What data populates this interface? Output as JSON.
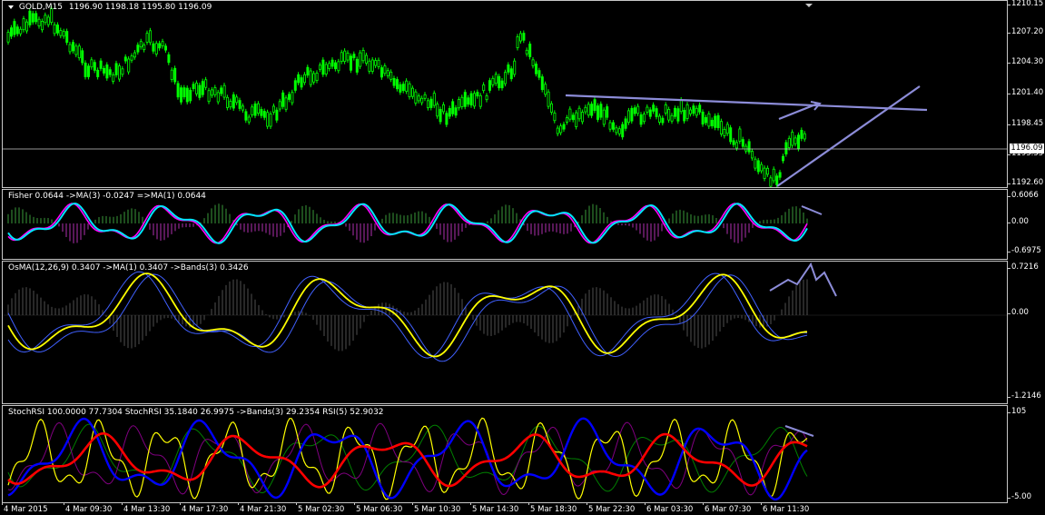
{
  "chart_title": {
    "symbol": "GOLD,M15",
    "ohlc": "1196.90 1198.18 1195.80 1196.09"
  },
  "current_price": "1196.09",
  "panes": {
    "main": {
      "axis": [
        "1210.15",
        "1207.20",
        "1204.30",
        "1201.40",
        "1198.45",
        "1195.55",
        "1192.60"
      ]
    },
    "fisher": {
      "label": "Fisher 0.0644  ->MA(3) -0.0247  =>MA(1) 0.0644",
      "axis": [
        "0.6066",
        "0.00",
        "-0.6975"
      ]
    },
    "osma": {
      "label": "OsMA(12,26,9) 0.3407  ->MA(1) 0.3407  ->Bands(3) 0.3426",
      "axis": [
        "0.7216",
        "0.00",
        "-1.2146"
      ]
    },
    "stoch": {
      "label": "StochRSI 100.0000 77.7304  StochRSI 35.1840 26.9975  ->Bands(3) 29.2354  RSI(5) 52.9032",
      "axis": [
        "105",
        "-5.00"
      ]
    }
  },
  "time_axis": [
    "4 Mar 2015",
    "4 Mar 09:30",
    "4 Mar 13:30",
    "4 Mar 17:30",
    "4 Mar 21:30",
    "5 Mar 02:30",
    "5 Mar 06:30",
    "5 Mar 10:30",
    "5 Mar 14:30",
    "5 Mar 18:30",
    "5 Mar 22:30",
    "6 Mar 03:30",
    "6 Mar 07:30",
    "6 Mar 11:30"
  ],
  "colors": {
    "candles": "#00ff00",
    "trendline": "#8c8cd8",
    "fisher_main": "#00e5ff",
    "fisher_signal": "#ff00ff",
    "osma_yellow": "#ffff00",
    "osma_blue": "#4060ff",
    "stoch_blue": "#0000ff",
    "stoch_red": "#ff0000",
    "stoch_yellow": "#ffff00"
  }
}
